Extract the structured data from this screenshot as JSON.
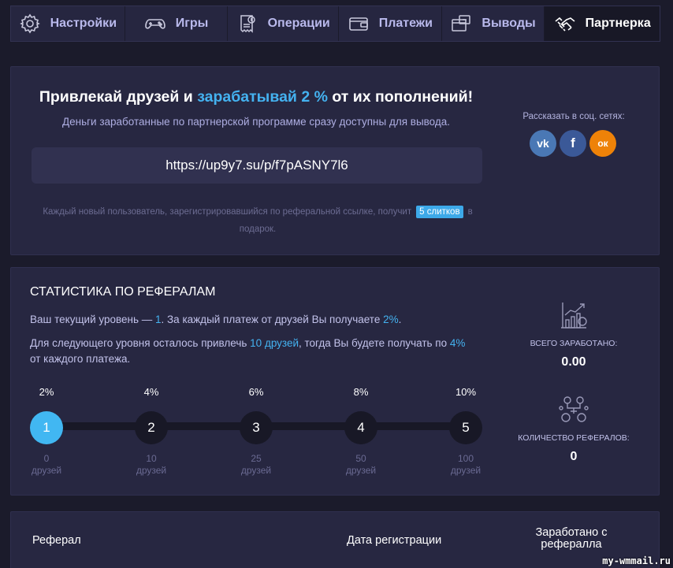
{
  "tabs": [
    {
      "label": "Настройки",
      "icon": "gear-icon"
    },
    {
      "label": "Игры",
      "icon": "gamepad-icon"
    },
    {
      "label": "Операции",
      "icon": "receipt-icon"
    },
    {
      "label": "Платежи",
      "icon": "wallet-icon"
    },
    {
      "label": "Выводы",
      "icon": "withdraw-icon"
    },
    {
      "label": "Партнерка",
      "icon": "handshake-icon",
      "active": true
    }
  ],
  "promo": {
    "headline_start": "Привлекай друзей и ",
    "headline_accent": "зарабатывай 2 %",
    "headline_end": " от их пополнений!",
    "subline": "Деньги заработанные по партнерской программе сразу доступны для вывода.",
    "link": "https://up9y7.su/p/f7pASNY7l6",
    "note_start": "Каждый новый пользователь, зарегистрировавшийся по реферальной ссылке, получит",
    "note_badge": "5 слитков",
    "note_end": "в подарок.",
    "social_title": "Рассказать в соц. сетях:",
    "social": {
      "vk": "vk",
      "fb": "f",
      "ok": "ок"
    }
  },
  "stats": {
    "title": "СТАТИСТИКА ПО РЕФЕРАЛАМ",
    "line1_a": "Ваш текущий уровень — ",
    "line1_level": "1",
    "line1_b": ". За каждый платеж от друзей Вы получаете ",
    "line1_pct": "2%",
    "line1_c": ".",
    "line2_a": "Для следующего уровня осталось привлечь ",
    "line2_friends": "10 друзей",
    "line2_b": ", тогда Вы будете получать по ",
    "line2_pct": "4%",
    "line2_c": "от каждого платежа.",
    "levels": [
      {
        "pct": "2%",
        "num": "1",
        "count": "0",
        "unit": "друзей",
        "active": true
      },
      {
        "pct": "4%",
        "num": "2",
        "count": "10",
        "unit": "друзей"
      },
      {
        "pct": "6%",
        "num": "3",
        "count": "25",
        "unit": "друзей"
      },
      {
        "pct": "8%",
        "num": "4",
        "count": "50",
        "unit": "друзей"
      },
      {
        "pct": "10%",
        "num": "5",
        "count": "100",
        "unit": "друзей"
      }
    ],
    "earned_label": "ВСЕГО ЗАРАБОТАНО:",
    "earned_value": "0.00",
    "referrals_label": "КОЛИЧЕСТВО РЕФЕРАЛОВ:",
    "referrals_value": "0"
  },
  "table": {
    "col1": "Реферал",
    "col2": "Дата регистрации",
    "col3_line1": "Заработано с",
    "col3_line2": "рефералла"
  },
  "watermark": "my-wmmail.ru",
  "colors": {
    "accent": "#44b2f0",
    "background": "#1b1b2b",
    "panel": "#272741"
  }
}
